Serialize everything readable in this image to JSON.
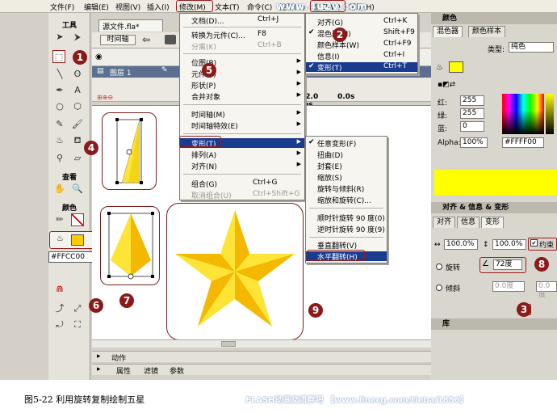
{
  "menubar": {
    "items": [
      "文件(F)",
      "编辑(E)",
      "视图(V)",
      "插入(I)",
      "修改(M)",
      "文本(T)",
      "命令(C)",
      "控制(O)",
      "窗口(W)",
      "帮助(H)"
    ]
  },
  "watermark_top": "www.4u2v.com",
  "toolbox": {
    "title": "工具",
    "view_title": "查看",
    "colors_title": "颜色",
    "hex_value": "#FFCC00"
  },
  "document": {
    "tab_title": "源文件.fla*",
    "timeline_label": "时间轴",
    "layer_name": "图层 1",
    "fps": "12.0 fps",
    "time": "0.0s",
    "actions_panel": "动作",
    "props_tabs": [
      "属性",
      "滤镜",
      "参数"
    ]
  },
  "modify_menu": {
    "items": [
      {
        "label": "文档(D)...",
        "shortcut": "Ctrl+J",
        "disabled": false
      },
      {
        "label": "转换为元件(C)...",
        "shortcut": "F8",
        "disabled": false
      },
      {
        "label": "分离(K)",
        "shortcut": "Ctrl+B",
        "disabled": true
      },
      {
        "label": "位图(B)",
        "shortcut": "",
        "disabled": false,
        "sub": true
      },
      {
        "label": "元件(S)",
        "shortcut": "",
        "disabled": false,
        "sub": true
      },
      {
        "label": "形状(P)",
        "shortcut": "",
        "disabled": false,
        "sub": true
      },
      {
        "label": "合并对象",
        "shortcut": "",
        "disabled": false,
        "sub": true
      },
      {
        "label": "时间轴(M)",
        "shortcut": "",
        "disabled": false,
        "sub": true
      },
      {
        "label": "时间轴特效(E)",
        "shortcut": "",
        "disabled": false,
        "sub": true
      },
      {
        "label": "变形(T)",
        "shortcut": "",
        "disabled": false,
        "sub": true,
        "highlight": true
      },
      {
        "label": "排列(A)",
        "shortcut": "",
        "disabled": false,
        "sub": true
      },
      {
        "label": "对齐(N)",
        "shortcut": "",
        "disabled": false,
        "sub": true
      },
      {
        "label": "组合(G)",
        "shortcut": "Ctrl+G",
        "disabled": false
      },
      {
        "label": "取消组合(U)",
        "shortcut": "Ctrl+Shift+G",
        "disabled": true
      }
    ]
  },
  "transform_submenu": {
    "items": [
      {
        "label": "任意变形(F)",
        "checked": true
      },
      {
        "label": "扭曲(D)"
      },
      {
        "label": "封套(E)"
      },
      {
        "label": "缩放(S)"
      },
      {
        "label": "旋转与倾斜(R)"
      },
      {
        "label": "缩放和旋转(C)..."
      },
      {
        "label": "顺时针旋转 90 度(0)"
      },
      {
        "label": "逆时针旋转 90 度(9)"
      },
      {
        "label": "垂直翻转(V)"
      },
      {
        "label": "水平翻转(H)",
        "highlight": true
      }
    ]
  },
  "window_menu": {
    "items": [
      {
        "label": "对齐(G)",
        "shortcut": "Ctrl+K"
      },
      {
        "label": "混色器(M)",
        "shortcut": "Shift+F9",
        "checked": true
      },
      {
        "label": "颜色样本(W)",
        "shortcut": "Ctrl+F9"
      },
      {
        "label": "信息(I)",
        "shortcut": "Ctrl+I"
      },
      {
        "label": "变形(T)",
        "shortcut": "Ctrl+T",
        "checked": true,
        "highlight": true
      }
    ]
  },
  "color_panel": {
    "title": "颜色",
    "tabs": [
      "混色器",
      "颜色样本"
    ],
    "type_label": "类型:",
    "type_value": "纯色",
    "red_label": "红:",
    "red": "255",
    "green_label": "绿:",
    "green": "255",
    "blue_label": "蓝:",
    "blue": "0",
    "alpha_label": "Alpha:",
    "alpha": "100%",
    "hex": "#FFFF00",
    "swatch_color": "#ffff00"
  },
  "transform_panel": {
    "title": "对齐 & 信息 & 变形",
    "tabs": [
      "对齐",
      "信息",
      "变形"
    ],
    "width_pct": "100.0%",
    "height_pct": "100.0%",
    "constrain_label": "约束",
    "rotate_label": "旋转",
    "rotate_value": "72度",
    "skew_label": "倾斜",
    "skew_x": "0.0度",
    "skew_y": "0.0度"
  },
  "library_panel": {
    "title": "库"
  },
  "steps": [
    "1",
    "2",
    "3",
    "4",
    "5",
    "6",
    "7",
    "8",
    "9"
  ],
  "caption": {
    "text": "图5-22 利用旋转复制绘制五星",
    "watermark": "FLASH动画交流群吧 【www.linecg.com/tieba/1856】"
  },
  "colors": {
    "star_light": "#ffe438",
    "star_dark": "#f5b800",
    "accent_red": "#8b1a1a",
    "menu_highlight": "#1a3c8f"
  }
}
